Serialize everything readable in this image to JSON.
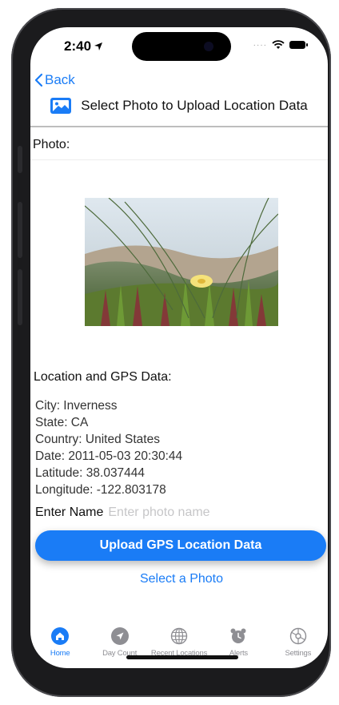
{
  "status": {
    "time": "2:40"
  },
  "nav": {
    "back_label": "Back",
    "title": "Select Photo to Upload Location Data"
  },
  "photo_section": {
    "label": "Photo:"
  },
  "location": {
    "heading": "Location and GPS Data:",
    "city": "City: Inverness",
    "state": "State: CA",
    "country": "Country: United States",
    "date": "Date: 2011-05-03 20:30:44",
    "latitude": "Latitude: 38.037444",
    "longitude": "Longitude: -122.803178"
  },
  "name_field": {
    "label": "Enter Name",
    "placeholder": "Enter photo name",
    "value": ""
  },
  "buttons": {
    "upload": "Upload GPS Location Data",
    "select_photo": "Select a Photo"
  },
  "tabs": [
    {
      "label": "Home",
      "icon": "house-icon",
      "active": true
    },
    {
      "label": "Day Count",
      "icon": "location-arrow-icon",
      "active": false
    },
    {
      "label": "Recent Locations",
      "icon": "globe-icon",
      "active": false
    },
    {
      "label": "Alerts",
      "icon": "alarm-clock-icon",
      "active": false
    },
    {
      "label": "Settings",
      "icon": "gear-icon",
      "active": false
    }
  ],
  "colors": {
    "accent": "#1a7cf6",
    "inactive_tab": "#8e8e93",
    "text": "#111111"
  }
}
